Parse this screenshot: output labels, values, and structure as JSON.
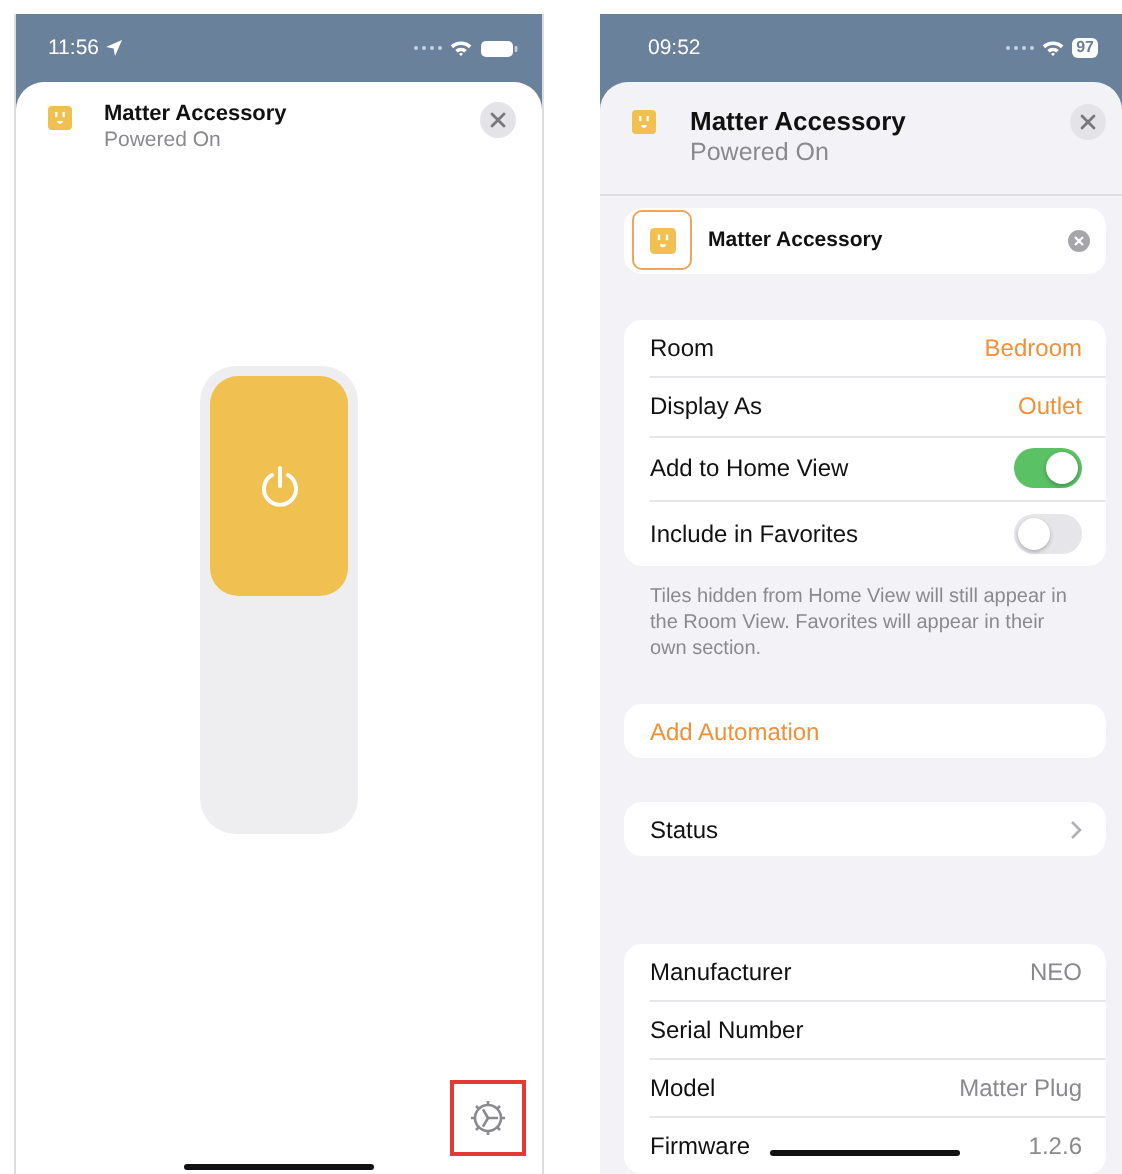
{
  "control_screen": {
    "status_bar": {
      "time": "11:56"
    },
    "header": {
      "title": "Matter Accessory",
      "subtitle": "Powered On"
    },
    "power_tile": {
      "on": true
    },
    "settings_button": {
      "highlighted": true
    }
  },
  "detail_screen": {
    "status_bar": {
      "time": "09:52",
      "battery": "97"
    },
    "header": {
      "title": "Matter Accessory",
      "subtitle": "Powered On"
    },
    "name_field": {
      "value": "Matter Accessory"
    },
    "settings": [
      {
        "kind": "value",
        "label": "Room",
        "value": "Bedroom"
      },
      {
        "kind": "value",
        "label": "Display As",
        "value": "Outlet"
      },
      {
        "kind": "toggle",
        "label": "Add to Home View",
        "on": true
      },
      {
        "kind": "toggle",
        "label": "Include in Favorites",
        "on": false
      }
    ],
    "settings_note": "Tiles hidden from Home View will still appear in the Room View. Favorites will appear in their own section.",
    "add_automation": "Add Automation",
    "status_row": {
      "label": "Status"
    },
    "info": [
      {
        "label": "Manufacturer",
        "value": "NEO"
      },
      {
        "label": "Serial Number"
      },
      {
        "label": "Model",
        "value": "Matter Plug"
      },
      {
        "label": "Firmware",
        "value": "1.2.6"
      }
    ]
  }
}
